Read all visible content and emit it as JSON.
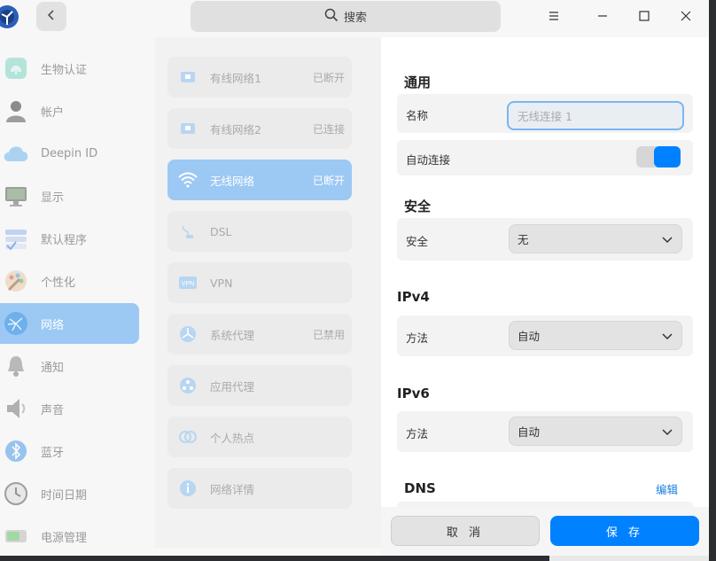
{
  "titlebar": {
    "search_placeholder": "搜索",
    "icons": [
      "app-logo-icon",
      "back-arrow-icon",
      "search-icon",
      "menu-icon",
      "minimize-icon",
      "maximize-icon",
      "close-icon"
    ]
  },
  "sidebar": {
    "items": [
      {
        "label": "生物认证",
        "icon": "fingerprint-icon",
        "active": false
      },
      {
        "label": "帐户",
        "icon": "account-icon",
        "active": false
      },
      {
        "label": "Deepin ID",
        "icon": "cloud-icon",
        "active": false
      },
      {
        "label": "显示",
        "icon": "monitor-icon",
        "active": false
      },
      {
        "label": "默认程序",
        "icon": "default-apps-icon",
        "active": false
      },
      {
        "label": "个性化",
        "icon": "palette-icon",
        "active": false
      },
      {
        "label": "网络",
        "icon": "network-icon",
        "active": true
      },
      {
        "label": "通知",
        "icon": "bell-icon",
        "active": false
      },
      {
        "label": "声音",
        "icon": "speaker-icon",
        "active": false
      },
      {
        "label": "蓝牙",
        "icon": "bluetooth-icon",
        "active": false
      },
      {
        "label": "时间日期",
        "icon": "clock-icon",
        "active": false
      },
      {
        "label": "电源管理",
        "icon": "battery-icon",
        "active": false
      }
    ]
  },
  "network_list": {
    "items": [
      {
        "label": "有线网络1",
        "status": "已断开",
        "icon": "wired-icon",
        "active": false
      },
      {
        "label": "有线网络2",
        "status": "已连接",
        "icon": "wired-icon",
        "active": false
      },
      {
        "label": "无线网络",
        "status": "已断开",
        "icon": "wifi-icon",
        "active": true
      },
      {
        "label": "DSL",
        "status": "",
        "icon": "dsl-icon",
        "active": false
      },
      {
        "label": "VPN",
        "status": "",
        "icon": "vpn-icon",
        "active": false
      },
      {
        "label": "系统代理",
        "status": "已禁用",
        "icon": "system-proxy-icon",
        "active": false
      },
      {
        "label": "应用代理",
        "status": "",
        "icon": "app-proxy-icon",
        "active": false
      },
      {
        "label": "个人热点",
        "status": "",
        "icon": "hotspot-icon",
        "active": false
      },
      {
        "label": "网络详情",
        "status": "",
        "icon": "info-icon",
        "active": false
      }
    ]
  },
  "detail": {
    "general": {
      "title": "通用",
      "name_label": "名称",
      "name_placeholder": "无线连接 1",
      "autoconnect_label": "自动连接",
      "autoconnect_on": true
    },
    "security": {
      "title": "安全",
      "label": "安全",
      "value": "无"
    },
    "ipv4": {
      "title": "IPv4",
      "method_label": "方法",
      "method_value": "自动"
    },
    "ipv6": {
      "title": "IPv6",
      "method_label": "方法",
      "method_value": "自动"
    },
    "dns": {
      "title": "DNS",
      "edit_label": "编辑"
    }
  },
  "buttons": {
    "cancel": "取 消",
    "save": "保 存"
  },
  "colors": {
    "accent": "#0081ff",
    "selection": "#9cc8f4"
  }
}
